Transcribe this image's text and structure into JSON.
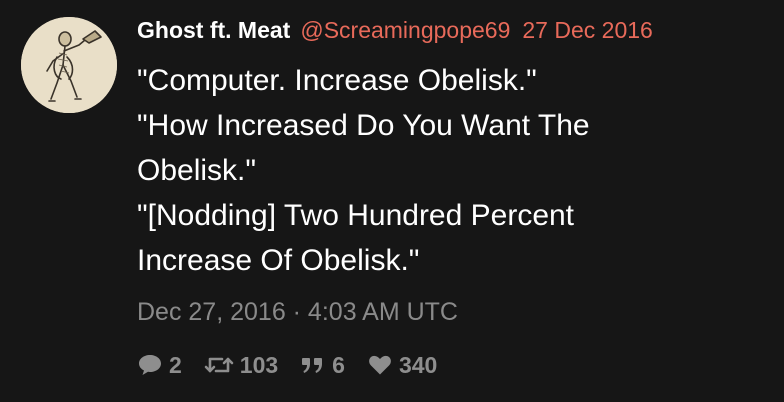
{
  "tweet": {
    "author": {
      "display_name": "Ghost ft. Meat",
      "handle": "@Screamingpope69",
      "avatar_icon": "engraved-figure-avatar"
    },
    "date_short": "27 Dec 2016",
    "lines": [
      "\"Computer. Increase Obelisk.\"",
      "\"How Increased Do You Want The",
      "Obelisk.\"",
      "\"[Nodding] Two Hundred Percent",
      "Increase Of Obelisk.\""
    ],
    "timestamp": "Dec 27, 2016 · 4:03 AM UTC",
    "stats": {
      "replies": "2",
      "retweets": "103",
      "quotes": "6",
      "likes": "340"
    },
    "icons": {
      "replies": "comment-icon",
      "retweets": "retweet-icon",
      "quotes": "quote-icon",
      "likes": "heart-icon"
    },
    "colors": {
      "background": "#161616",
      "accent": "#e86a5a",
      "muted": "#8a8a8a",
      "text": "#ffffff"
    }
  }
}
